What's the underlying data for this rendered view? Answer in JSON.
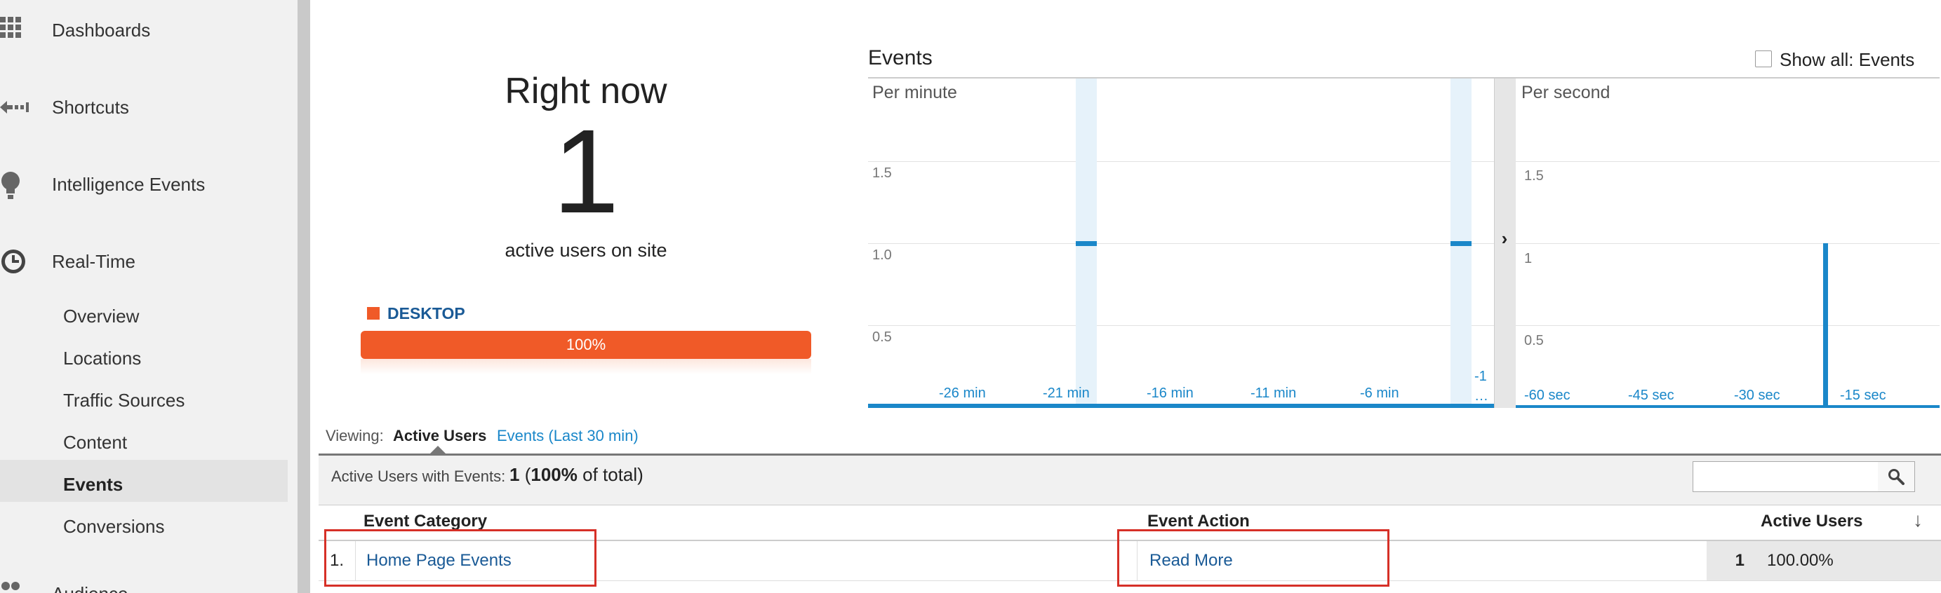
{
  "sidebar": {
    "items": [
      {
        "label": "Dashboards",
        "icon": "grid-icon"
      },
      {
        "label": "Shortcuts",
        "icon": "shortcut-arrow-icon"
      },
      {
        "label": "Intelligence Events",
        "icon": "lightbulb-icon"
      },
      {
        "label": "Real-Time",
        "icon": "clock-icon"
      }
    ],
    "subitems": [
      "Overview",
      "Locations",
      "Traffic Sources",
      "Content",
      "Events",
      "Conversions"
    ],
    "active_subitem": "Events",
    "partial_item": "Audience"
  },
  "right_now": {
    "title": "Right now",
    "count": "1",
    "subtitle": "active users on site",
    "device_label": "DESKTOP",
    "device_percent_label": "100%",
    "device_percent": 100,
    "device_color": "#f05a28"
  },
  "events_panel": {
    "title": "Events",
    "show_all_label": "Show all: Events",
    "show_all_checked": false
  },
  "chart_data": [
    {
      "type": "bar",
      "title": "Per minute",
      "ylim": [
        0,
        1.5
      ],
      "y_ticks": [
        "1.5",
        "1.0",
        "0.5"
      ],
      "x_ticks": [
        "-26 min",
        "-21 min",
        "-16 min",
        "-11 min",
        "-6 min",
        "-1 …"
      ],
      "bars": [
        {
          "x": -21,
          "value": 1
        },
        {
          "x": -2,
          "value": 1
        }
      ]
    },
    {
      "type": "bar",
      "title": "Per second",
      "ylim": [
        0,
        1.5
      ],
      "y_ticks": [
        "1.5",
        "1",
        "0.5"
      ],
      "x_ticks": [
        "-60 sec",
        "-45 sec",
        "-30 sec",
        "-15 sec"
      ],
      "bars": [
        {
          "x": -17,
          "value": 1
        }
      ]
    }
  ],
  "chart_ui": {
    "expand_arrow": "›"
  },
  "viewing": {
    "label": "Viewing:",
    "active": "Active Users",
    "alternate": "Events (Last 30 min)"
  },
  "summary": {
    "label": "Active Users with Events:",
    "value_number": "1",
    "value_paren_open": "(",
    "value_percent": "100%",
    "value_rest": "of total)"
  },
  "table": {
    "headers": [
      "Event Category",
      "Event Action",
      "Active Users"
    ],
    "rows": [
      {
        "num": "1.",
        "category": "Home Page Events",
        "action": "Read More",
        "users": "1",
        "percent": "100.00%"
      }
    ]
  },
  "colors": {
    "accent": "#1a87c9",
    "bar": "#1a87c9",
    "highlight": "#d63027",
    "orange": "#f05a28"
  }
}
